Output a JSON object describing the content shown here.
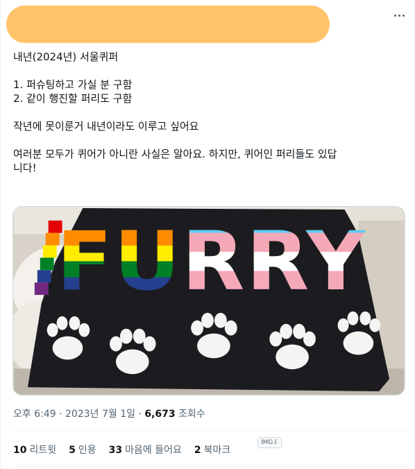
{
  "tweet": {
    "lines": [
      "내년(2024년) 서울퀴퍼",
      "",
      "1. 퍼슈팅하고 가실 분 구함",
      "2. 같이 행진할 퍼리도 구함",
      "",
      "작년에 못이룬거 내년이라도 이루고 싶어요",
      "",
      "여러분 모두가 퀴어가 아니란 사실은 알아요. 하지만, 퀴어인 퍼리들도 있답",
      "니다!"
    ],
    "image": {
      "flag_text": "FURRY",
      "stripe_colors": [
        "#e40303",
        "#ff8c00",
        "#ffed00",
        "#008026",
        "#24408e",
        "#732982"
      ],
      "trans_colors": [
        "#5bcefa",
        "#f5a9b8",
        "#ffffff"
      ],
      "flag_background": "#1c1c20"
    },
    "time": "오후 6:49",
    "date": "2023년 7월 1일",
    "separator": "·",
    "views_count": "6,673",
    "views_label": "조회수",
    "alt_badge": "IMG⇩",
    "stats": {
      "retweets": {
        "count": "10",
        "label": "리트윗"
      },
      "quotes": {
        "count": "5",
        "label": "인용"
      },
      "likes": {
        "count": "33",
        "label": "마음에 들어요"
      },
      "bookmarks": {
        "count": "2",
        "label": "북마크"
      }
    }
  }
}
